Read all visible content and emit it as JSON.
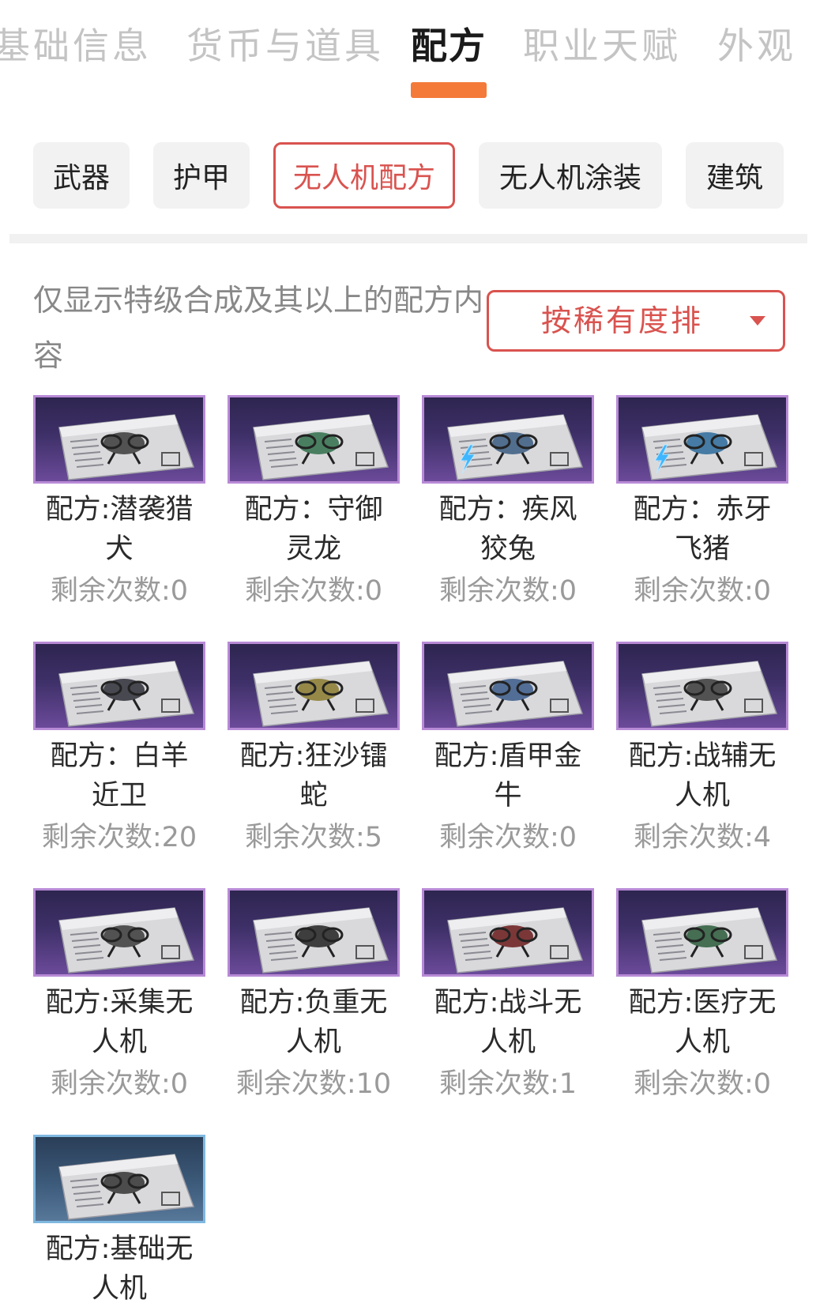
{
  "top_tabs": [
    {
      "label": "基础信息",
      "active": false
    },
    {
      "label": "货币与道具",
      "active": false
    },
    {
      "label": "配方",
      "active": true
    },
    {
      "label": "职业天赋",
      "active": false
    },
    {
      "label": "外观",
      "active": false
    }
  ],
  "categories": [
    {
      "label": "武器",
      "active": false
    },
    {
      "label": "护甲",
      "active": false
    },
    {
      "label": "无人机配方",
      "active": true
    },
    {
      "label": "无人机涂装",
      "active": false
    },
    {
      "label": "建筑",
      "active": false
    }
  ],
  "notice": "仅显示特级合成及其以上的配方内容",
  "sort": {
    "label": "按稀有度排",
    "icon": "caret-down-icon"
  },
  "colors": {
    "accent": "#d9534f",
    "tab_indicator": "#f47a3a",
    "rarity_purple_border": "#b88ad6",
    "rarity_blue_border": "#7fb8e0"
  },
  "recipes": [
    {
      "name_line1": "配方:潜袭猎",
      "name_line2": "犬",
      "count": "剩余次数:0",
      "rarity": "purple",
      "lightning": false
    },
    {
      "name_line1": "配方：守御",
      "name_line2": "灵龙",
      "count": "剩余次数:0",
      "rarity": "purple",
      "lightning": false
    },
    {
      "name_line1": "配方：疾风",
      "name_line2": "狡兔",
      "count": "剩余次数:0",
      "rarity": "purple",
      "lightning": true
    },
    {
      "name_line1": "配方：赤牙",
      "name_line2": "飞猪",
      "count": "剩余次数:0",
      "rarity": "purple",
      "lightning": true
    },
    {
      "name_line1": "配方：白羊",
      "name_line2": "近卫",
      "count": "剩余次数:20",
      "rarity": "purple",
      "lightning": false
    },
    {
      "name_line1": "配方:狂沙镭",
      "name_line2": "蛇",
      "count": "剩余次数:5",
      "rarity": "purple",
      "lightning": false
    },
    {
      "name_line1": "配方:盾甲金",
      "name_line2": "牛",
      "count": "剩余次数:0",
      "rarity": "purple",
      "lightning": false
    },
    {
      "name_line1": "配方:战辅无",
      "name_line2": "人机",
      "count": "剩余次数:4",
      "rarity": "purple",
      "lightning": false
    },
    {
      "name_line1": "配方:采集无",
      "name_line2": "人机",
      "count": "剩余次数:0",
      "rarity": "purple",
      "lightning": false
    },
    {
      "name_line1": "配方:负重无",
      "name_line2": "人机",
      "count": "剩余次数:10",
      "rarity": "purple",
      "lightning": false
    },
    {
      "name_line1": "配方:战斗无",
      "name_line2": "人机",
      "count": "剩余次数:1",
      "rarity": "purple",
      "lightning": false
    },
    {
      "name_line1": "配方:医疗无",
      "name_line2": "人机",
      "count": "剩余次数:0",
      "rarity": "purple",
      "lightning": false
    },
    {
      "name_line1": "配方:基础无",
      "name_line2": "人机",
      "count": "",
      "rarity": "blue",
      "lightning": false
    }
  ]
}
